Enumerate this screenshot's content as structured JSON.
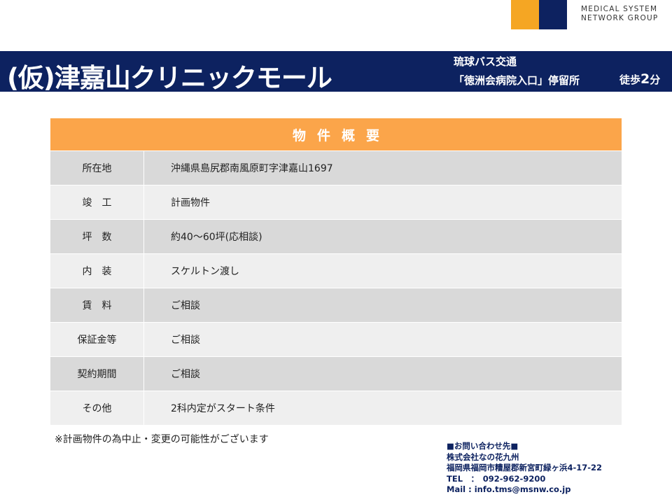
{
  "logo": {
    "line1": "MEDICAL SYSTEM",
    "line2": "NETWORK GROUP",
    "colors": {
      "orange": "#f5a623",
      "navy": "#0d2260"
    }
  },
  "banner": {
    "title": "(仮)津嘉山クリニックモール",
    "bus_company": "琉球バス交通",
    "bus_stop": "「徳洲会病院入口」停留所",
    "walk_prefix": "徒歩",
    "walk_minutes": "2",
    "walk_unit": "分"
  },
  "table": {
    "header": "物件概要",
    "rows": [
      {
        "label": "所在地",
        "value": "沖縄県島尻郡南風原町字津嘉山1697"
      },
      {
        "label": "竣　工",
        "value": "計画物件"
      },
      {
        "label": "坪　数",
        "value": "約40～60坪(応相談)"
      },
      {
        "label": "内　装",
        "value": "スケルトン渡し"
      },
      {
        "label": "賃　料",
        "value": "ご相談"
      },
      {
        "label": "保証金等",
        "value": "ご相談"
      },
      {
        "label": "契約期間",
        "value": "ご相談"
      },
      {
        "label": "その他",
        "value": "2科内定がスタート条件"
      }
    ]
  },
  "note": "※計画物件の為中止・変更の可能性がございます",
  "contact": {
    "heading": "■お問い合わせ先■",
    "company": "株式会社なの花九州",
    "address": "福岡県福岡市糟屋郡新宮町緑ヶ浜4-17-22",
    "tel": "TEL　：　092-962-9200",
    "mail": "Mail : info.tms@msnw.co.jp"
  },
  "colors": {
    "navy": "#0d2260",
    "header_orange": "#fba54a",
    "row_dark": "#d9d9d9",
    "row_light": "#efefef"
  }
}
